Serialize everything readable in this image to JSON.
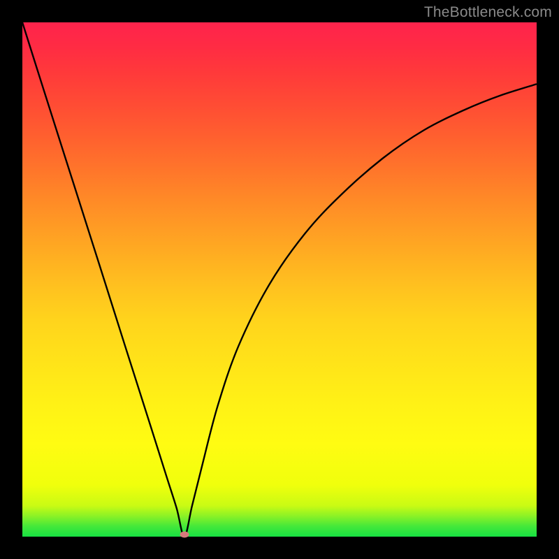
{
  "watermark": "TheBottleneck.com",
  "marker": {
    "x_frac": 0.315,
    "y_frac": 0.996
  },
  "colors": {
    "curve_stroke": "#000000",
    "marker_fill": "#d67a7c",
    "watermark": "#8a8a8a"
  },
  "chart_data": {
    "type": "line",
    "title": "",
    "xlabel": "",
    "ylabel": "",
    "xlim": [
      0,
      1
    ],
    "ylim": [
      0,
      1
    ],
    "series": [
      {
        "name": "bottleneck-curve",
        "x": [
          0.0,
          0.05,
          0.1,
          0.15,
          0.2,
          0.25,
          0.28,
          0.3,
          0.315,
          0.33,
          0.35,
          0.38,
          0.42,
          0.48,
          0.55,
          0.62,
          0.7,
          0.78,
          0.86,
          0.93,
          1.0
        ],
        "values": [
          1.0,
          0.842,
          0.685,
          0.528,
          0.37,
          0.213,
          0.118,
          0.055,
          0.0,
          0.06,
          0.14,
          0.255,
          0.37,
          0.49,
          0.59,
          0.665,
          0.735,
          0.79,
          0.83,
          0.858,
          0.88
        ]
      }
    ],
    "annotations": [
      {
        "name": "min-marker",
        "x": 0.315,
        "y": 0.0
      }
    ]
  }
}
